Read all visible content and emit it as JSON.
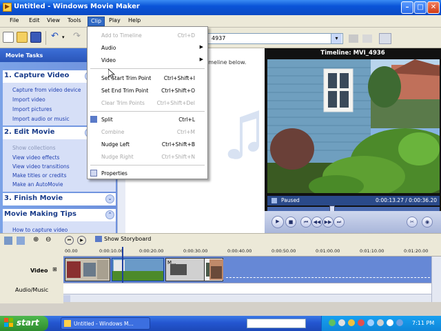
{
  "window": {
    "title": "Untitled - Windows Movie Maker",
    "app_icon": "movie-maker-icon",
    "controls": [
      "minimize-icon",
      "maximize-icon",
      "close-icon"
    ]
  },
  "menubar": {
    "items": [
      "File",
      "Edit",
      "View",
      "Tools",
      "Clip",
      "Play",
      "Help"
    ],
    "active": "Clip"
  },
  "toolbar": {
    "collection_value": "4937"
  },
  "clip_menu": {
    "items": [
      {
        "label": "Add to Timeline",
        "shortcut": "Ctrl+D",
        "enabled": false
      },
      {
        "label": "Audio",
        "submenu": true,
        "enabled": true
      },
      {
        "label": "Video",
        "submenu": true,
        "enabled": true
      },
      {
        "label": "Set Start Trim Point",
        "shortcut": "Ctrl+Shift+I",
        "enabled": true
      },
      {
        "label": "Set End Trim Point",
        "shortcut": "Ctrl+Shift+O",
        "enabled": true
      },
      {
        "label": "Clear Trim Points",
        "shortcut": "Ctrl+Shift+Del",
        "enabled": false
      },
      {
        "label": "Split",
        "shortcut": "Ctrl+L",
        "enabled": true
      },
      {
        "label": "Combine",
        "shortcut": "Ctrl+M",
        "enabled": false
      },
      {
        "label": "Nudge Left",
        "shortcut": "Ctrl+Shift+B",
        "enabled": true
      },
      {
        "label": "Nudge Right",
        "shortcut": "Ctrl+Shift+N",
        "enabled": false
      },
      {
        "label": "Properties",
        "enabled": true
      }
    ]
  },
  "tasks": {
    "header": "Movie Tasks",
    "sections": [
      {
        "title": "1. Capture Video",
        "links": [
          "Capture from video device",
          "Import video",
          "Import pictures",
          "Import audio or music"
        ]
      },
      {
        "title": "2. Edit Movie",
        "links": [
          "Show collections",
          "View video effects",
          "View video transitions",
          "Make titles or credits",
          "Make an AutoMovie"
        ],
        "disabled_first": true
      },
      {
        "title": "3. Finish Movie",
        "links": []
      },
      {
        "title": "Movie Making Tips",
        "links": [
          "How to capture video"
        ]
      }
    ]
  },
  "contents": {
    "hint": "imeline below."
  },
  "monitor": {
    "title": "Timeline: MVI_4936",
    "status": "Paused",
    "timecode": "0:00:13.27 / 0:00:36.20"
  },
  "timeline": {
    "storyboard_label": "Show Storyboard",
    "video_label": "Video",
    "audio_label": "Audio/Music",
    "ruler": [
      "00.00",
      "0:00:10.00",
      "0:00:20.00",
      "0:00:30.00",
      "0:00:40.00",
      "0:00:50.00",
      "0:01:00.00",
      "0:01:10.00",
      "0:01:20.00"
    ],
    "clip_text": "M..."
  },
  "taskbar": {
    "start": "start",
    "task_button": "Untitled - Windows M...",
    "clock": "7:11 PM"
  },
  "colors": {
    "titlebar": "#0a54d8",
    "menu_highlight": "#316ac5",
    "task_pane": "#6c8fdc",
    "timeline_track": "#6688d6"
  }
}
